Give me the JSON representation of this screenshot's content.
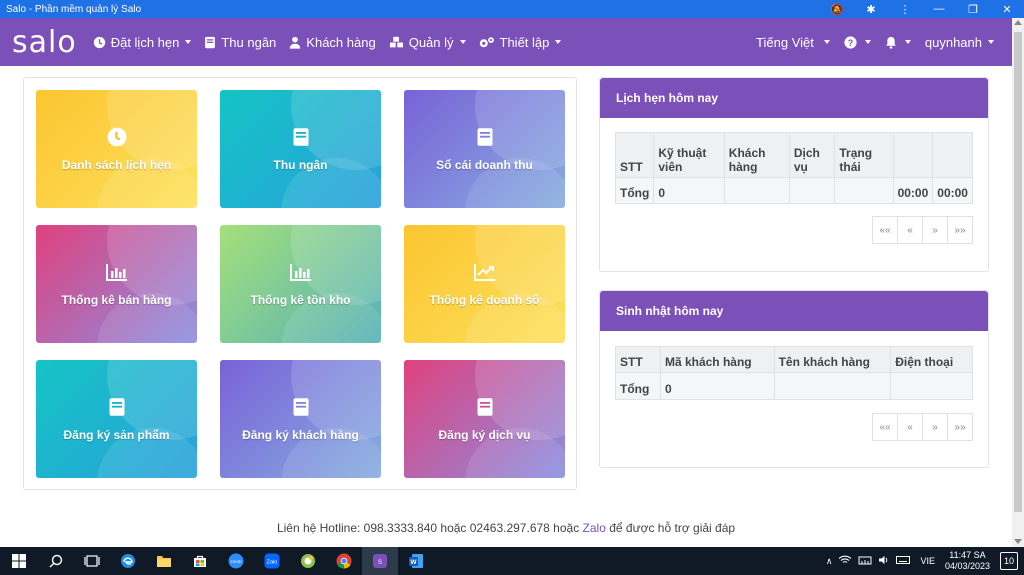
{
  "window": {
    "title": "Salo - Phần mềm quản lý Salo",
    "title_color": "#1e72e6"
  },
  "navbar": {
    "logo": "salo",
    "bg_color": "#7b50b8",
    "items": [
      {
        "label": "Đặt lịch hẹn",
        "icon": "clock-icon"
      },
      {
        "label": "Thu ngân",
        "icon": "book-icon"
      },
      {
        "label": "Khách hàng",
        "icon": "user-icon"
      },
      {
        "label": "Quản lý",
        "icon": "cubes-icon"
      },
      {
        "label": "Thiết lập",
        "icon": "cogs-icon"
      }
    ],
    "language": "Tiếng Việt",
    "username": "quynhanh"
  },
  "tiles": [
    {
      "label": "Danh sách lịch hẹn",
      "icon": "clock-icon",
      "color": "yellow"
    },
    {
      "label": "Thu ngân",
      "icon": "book-icon",
      "color": "cyan"
    },
    {
      "label": "Sổ cái doanh thu",
      "icon": "book-icon",
      "color": "purple"
    },
    {
      "label": "Thống kê bán hàng",
      "icon": "bar-chart-icon",
      "color": "pink"
    },
    {
      "label": "Thống kê tồn kho",
      "icon": "bar-chart-icon",
      "color": "green"
    },
    {
      "label": "Thống kê doanh số",
      "icon": "line-chart-icon",
      "color": "yellow"
    },
    {
      "label": "Đăng ký sản phẩm",
      "icon": "book-icon",
      "color": "cyan"
    },
    {
      "label": "Đăng ký khách hàng",
      "icon": "book-icon",
      "color": "purple"
    },
    {
      "label": "Đăng ký dịch vụ",
      "icon": "book-icon",
      "color": "pink"
    }
  ],
  "appointments": {
    "title": "Lịch hẹn hôm nay",
    "columns": [
      "STT",
      "Kỹ thuật viên",
      "Khách hàng",
      "Dịch vụ",
      "Trạng thái",
      "",
      ""
    ],
    "total_row": {
      "label": "Tổng",
      "count": "0",
      "time1": "00:00",
      "time2": "00:00"
    }
  },
  "birthdays": {
    "title": "Sinh nhật hôm nay",
    "columns": [
      "STT",
      "Mã khách hàng",
      "Tên khách hàng",
      "Điện thoại"
    ],
    "total_row": {
      "label": "Tổng",
      "count": "0"
    }
  },
  "pager": {
    "first": "««",
    "prev": "«",
    "next": "»",
    "last": "»»"
  },
  "footer": {
    "prefix": "Liên hệ Hotline: 098.3333.840 hoặc 02463.297.678 hoặc ",
    "link": "Zalo",
    "suffix": " để được hỗ trợ giải đáp"
  },
  "taskbar": {
    "language": "VIE",
    "time": "11:47 SA",
    "date": "04/03/2023",
    "notifications": "10"
  }
}
